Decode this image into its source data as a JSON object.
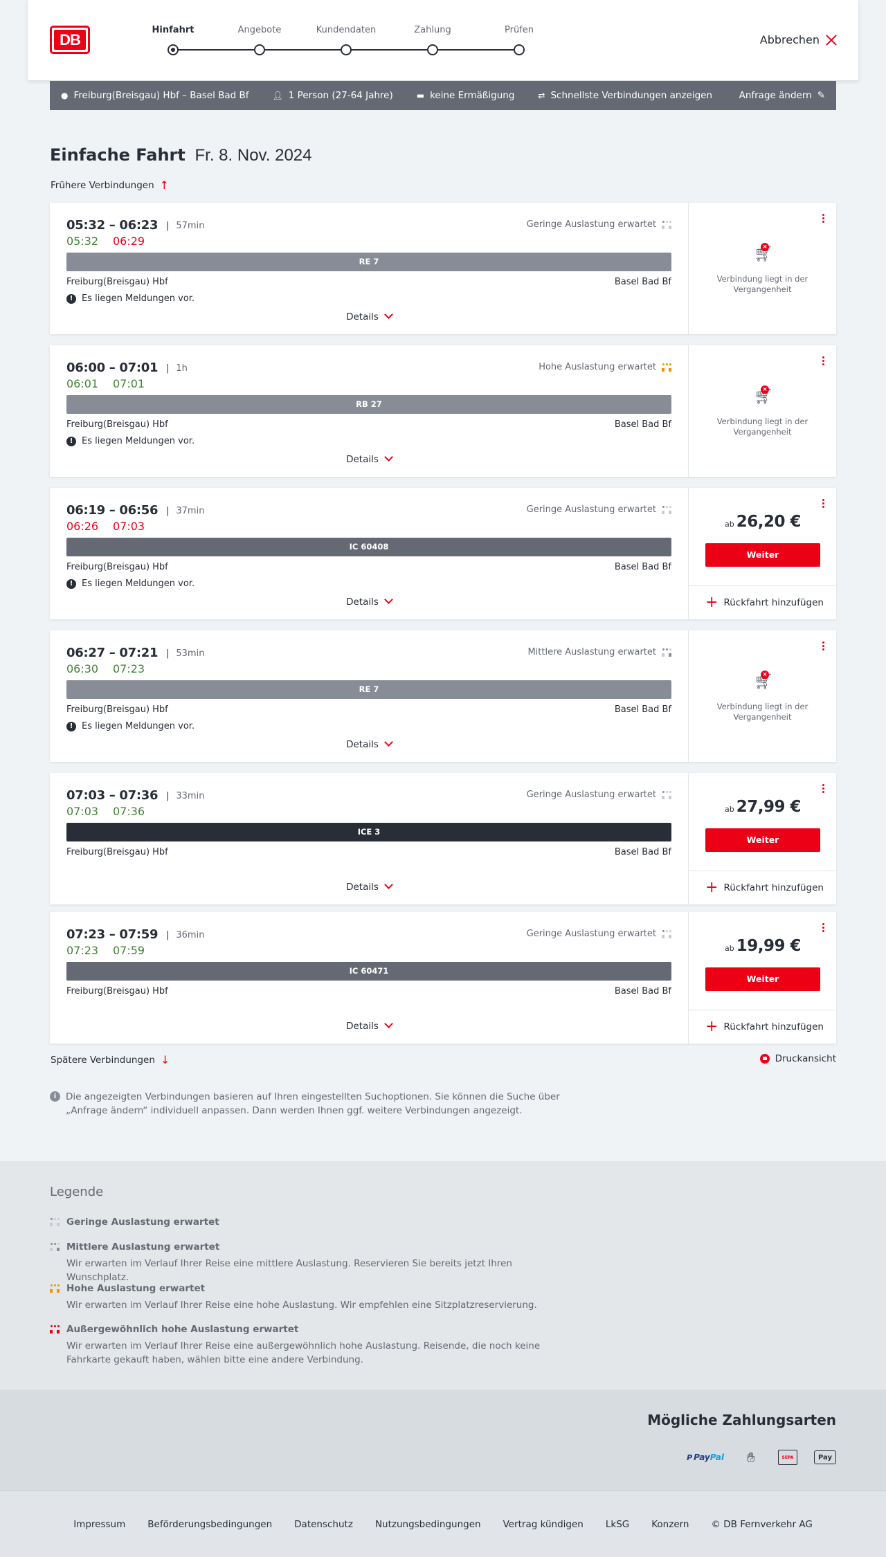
{
  "header": {
    "logo": "DB",
    "steps": [
      {
        "label": "Hinfahrt",
        "active": true
      },
      {
        "label": "Angebote",
        "active": false
      },
      {
        "label": "Kundendaten",
        "active": false
      },
      {
        "label": "Zahlung",
        "active": false
      },
      {
        "label": "Prüfen",
        "active": false
      }
    ],
    "cancel_label": "Abbrechen"
  },
  "search": {
    "route": "Freiburg(Breisgau) Hbf – Basel Bad Bf",
    "passengers": "1 Person (27-64 Jahre)",
    "discount": "keine Ermäßigung",
    "fastest": "Schnellste Verbindungen anzeigen",
    "edit_label": "Anfrage ändern"
  },
  "page": {
    "title": "Einfache Fahrt",
    "date": "Fr. 8. Nov. 2024",
    "earlier_label": "Frühere Verbindungen",
    "later_label": "Spätere Verbindungen",
    "print_label": "Druckansicht",
    "info_text": "Die angezeigten Verbindungen basieren auf Ihren eingestellten Suchoptionen. Sie können die Suche über „Anfrage ändern“ individuell anpassen. Dann werden Ihnen ggf. weitere Verbindungen angezeigt."
  },
  "connections": [
    {
      "times": "05:32 – 06:23",
      "duration": "57min",
      "rt_dep": "05:32",
      "rt_dep_status": "on",
      "rt_arr": "06:29",
      "rt_arr_status": "late",
      "occupancy": "Geringe Auslastung erwartet",
      "occupancy_level": "low",
      "train": "RE 7",
      "train_color": "#878c96",
      "from": "Freiburg(Breisgau) Hbf",
      "to": "Basel Bad Bf",
      "notice": "Es liegen Meldungen vor.",
      "details_label": "Details",
      "past": true,
      "past_text": "Verbindung liegt in der Vergangenheit"
    },
    {
      "times": "06:00 – 07:01",
      "duration": "1h",
      "rt_dep": "06:01",
      "rt_dep_status": "on",
      "rt_arr": "07:01",
      "rt_arr_status": "on",
      "occupancy": "Hohe Auslastung erwartet",
      "occupancy_level": "high",
      "train": "RB 27",
      "train_color": "#878c96",
      "from": "Freiburg(Breisgau) Hbf",
      "to": "Basel Bad Bf",
      "notice": "Es liegen Meldungen vor.",
      "details_label": "Details",
      "past": true,
      "past_text": "Verbindung liegt in der Vergangenheit"
    },
    {
      "times": "06:19 – 06:56",
      "duration": "37min",
      "rt_dep": "06:26",
      "rt_dep_status": "late",
      "rt_arr": "07:03",
      "rt_arr_status": "late",
      "occupancy": "Geringe Auslastung erwartet",
      "occupancy_level": "low",
      "train": "IC 60408",
      "train_color": "#646973",
      "from": "Freiburg(Breisgau) Hbf",
      "to": "Basel Bad Bf",
      "notice": "Es liegen Meldungen vor.",
      "details_label": "Details",
      "past": false,
      "price_prefix": "ab",
      "price": "26,20 €",
      "button": "Weiter",
      "return_label": "Rückfahrt hinzufügen"
    },
    {
      "times": "06:27 – 07:21",
      "duration": "53min",
      "rt_dep": "06:30",
      "rt_dep_status": "on",
      "rt_arr": "07:23",
      "rt_arr_status": "on",
      "occupancy": "Mittlere Auslastung erwartet",
      "occupancy_level": "medium",
      "train": "RE 7",
      "train_color": "#878c96",
      "from": "Freiburg(Breisgau) Hbf",
      "to": "Basel Bad Bf",
      "notice": "Es liegen Meldungen vor.",
      "details_label": "Details",
      "past": true,
      "past_text": "Verbindung liegt in der Vergangenheit"
    },
    {
      "times": "07:03 – 07:36",
      "duration": "33min",
      "rt_dep": "07:03",
      "rt_dep_status": "on",
      "rt_arr": "07:36",
      "rt_arr_status": "on",
      "occupancy": "Geringe Auslastung erwartet",
      "occupancy_level": "low",
      "train": "ICE 3",
      "train_color": "#282d37",
      "from": "Freiburg(Breisgau) Hbf",
      "to": "Basel Bad Bf",
      "notice": "",
      "details_label": "Details",
      "past": false,
      "price_prefix": "ab",
      "price": "27,99 €",
      "button": "Weiter",
      "return_label": "Rückfahrt hinzufügen"
    },
    {
      "times": "07:23 – 07:59",
      "duration": "36min",
      "rt_dep": "07:23",
      "rt_dep_status": "on",
      "rt_arr": "07:59",
      "rt_arr_status": "on",
      "occupancy": "Geringe Auslastung erwartet",
      "occupancy_level": "low",
      "train": "IC 60471",
      "train_color": "#646973",
      "from": "Freiburg(Breisgau) Hbf",
      "to": "Basel Bad Bf",
      "notice": "",
      "details_label": "Details",
      "past": false,
      "price_prefix": "ab",
      "price": "19,99 €",
      "button": "Weiter",
      "return_label": "Rückfahrt hinzufügen"
    }
  ],
  "legend": {
    "title": "Legende",
    "items": [
      {
        "level": "low",
        "title": "Geringe Auslastung erwartet",
        "desc": ""
      },
      {
        "level": "medium",
        "title": "Mittlere Auslastung erwartet",
        "desc": "Wir erwarten im Verlauf Ihrer Reise eine mittlere Auslastung. Reservieren Sie bereits jetzt Ihren Wunschplatz."
      },
      {
        "level": "high",
        "title": "Hohe Auslastung erwartet",
        "desc": "Wir erwarten im Verlauf Ihrer Reise eine hohe Auslastung. Wir empfehlen eine Sitzplatzreservierung."
      },
      {
        "level": "extreme",
        "title": "Außergewöhnlich hohe Auslastung erwartet",
        "desc": "Wir erwarten im Verlauf Ihrer Reise eine außergewöhnlich hohe Auslastung. Reisende, die noch keine Fahrkarte gekauft haben, wählen bitte eine andere Verbindung."
      }
    ]
  },
  "payment": {
    "title": "Mögliche Zahlungsarten",
    "methods": [
      "paypal-icon",
      "credit-card-icon",
      "sepa-icon",
      "apple-pay-icon"
    ],
    "paypal_a": "Pay",
    "paypal_b": "Pal",
    "apple_pay": "Pay",
    "sepa": "SEPA"
  },
  "footer": {
    "links": [
      "Impressum",
      "Beförderungsbedingungen",
      "Datenschutz",
      "Nutzungsbedingungen",
      "Vertrag kündigen",
      "LkSG",
      "Konzern",
      "© DB Fernverkehr AG"
    ]
  },
  "colors": {
    "brand": "#ec0016",
    "on_time": "#408335",
    "late": "#ec0016",
    "occupancy_low": "#c8ccd2",
    "occupancy_medium": "#878c96",
    "occupancy_high": "#f39200",
    "occupancy_extreme": "#ec0016"
  }
}
